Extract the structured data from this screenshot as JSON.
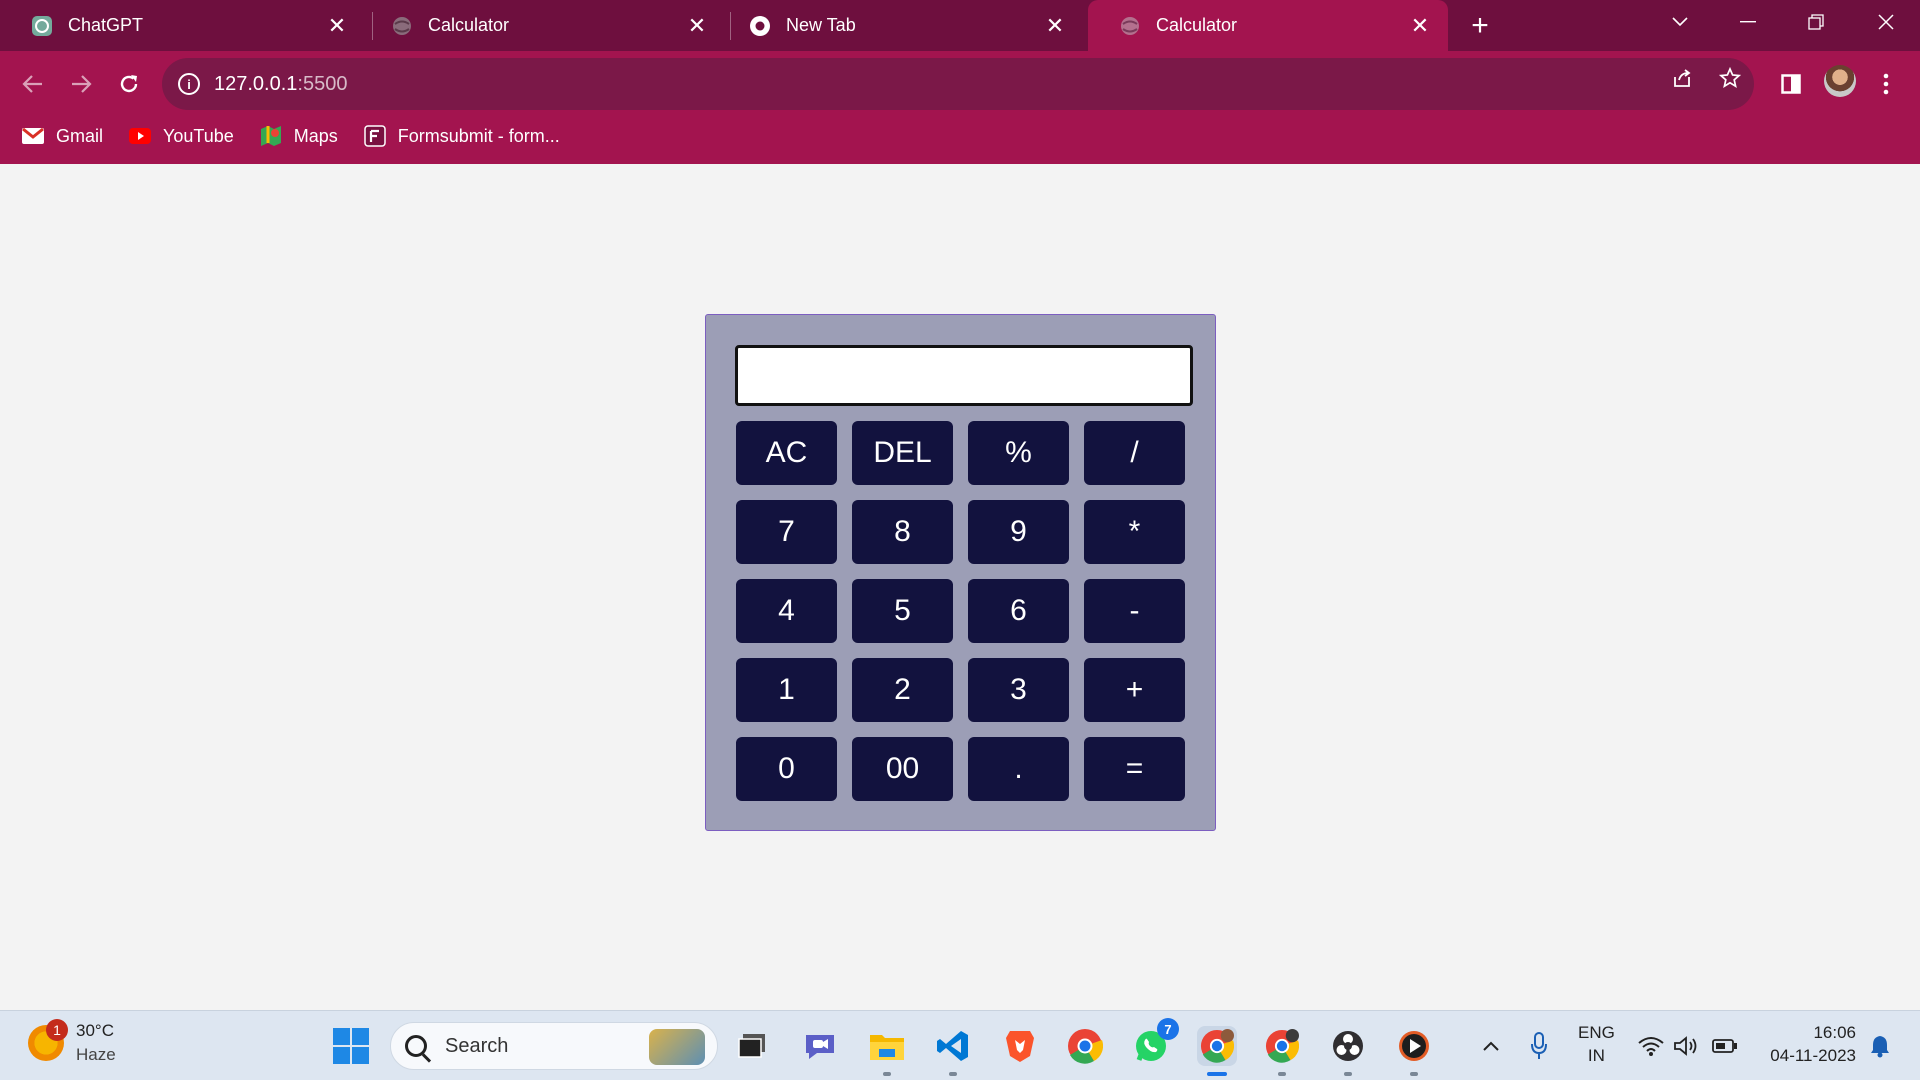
{
  "browser": {
    "tabs": [
      {
        "title": "ChatGPT",
        "icon": "chatgpt-icon",
        "active": false
      },
      {
        "title": "Calculator",
        "icon": "globe-icon",
        "active": false
      },
      {
        "title": "New Tab",
        "icon": "chrome-icon",
        "active": false
      },
      {
        "title": "Calculator",
        "icon": "globe-icon",
        "active": true
      }
    ],
    "close_glyph": "✕",
    "new_tab_glyph": "+",
    "url_host": "127.0.0.1",
    "url_port": ":5500",
    "bookmarks": [
      {
        "label": "Gmail",
        "icon": "gmail-icon"
      },
      {
        "label": "YouTube",
        "icon": "youtube-icon"
      },
      {
        "label": "Maps",
        "icon": "maps-icon"
      },
      {
        "label": "Formsubmit - form...",
        "icon": "formsubmit-icon"
      }
    ],
    "colors": {
      "tabstrip": "#6e0f3e",
      "toolbar": "#a3144f",
      "omnibox": "#7b1848"
    }
  },
  "calculator": {
    "display_value": "",
    "keys": [
      "AC",
      "DEL",
      "%",
      "/",
      "7",
      "8",
      "9",
      "*",
      "4",
      "5",
      "6",
      "-",
      "1",
      "2",
      "3",
      "+",
      "0",
      "00",
      ".",
      "="
    ],
    "colors": {
      "body": "#9c9eb6",
      "key": "#12123e",
      "key_text": "#ffffff"
    }
  },
  "taskbar": {
    "weather": {
      "temp": "30°C",
      "condition": "Haze",
      "badge": "1"
    },
    "search_placeholder": "Search",
    "apps": [
      {
        "name": "task-view",
        "badge": ""
      },
      {
        "name": "teams-chat",
        "badge": ""
      },
      {
        "name": "file-explorer",
        "badge": ""
      },
      {
        "name": "vscode",
        "badge": ""
      },
      {
        "name": "brave",
        "badge": ""
      },
      {
        "name": "chrome",
        "badge": ""
      },
      {
        "name": "whatsapp",
        "badge": "7"
      },
      {
        "name": "chrome-profile-1",
        "badge": ""
      },
      {
        "name": "chrome-profile-2",
        "badge": ""
      },
      {
        "name": "obs",
        "badge": ""
      },
      {
        "name": "media-player",
        "badge": ""
      }
    ],
    "language": {
      "line1": "ENG",
      "line2": "IN"
    },
    "time": "16:06",
    "date": "04-11-2023"
  }
}
